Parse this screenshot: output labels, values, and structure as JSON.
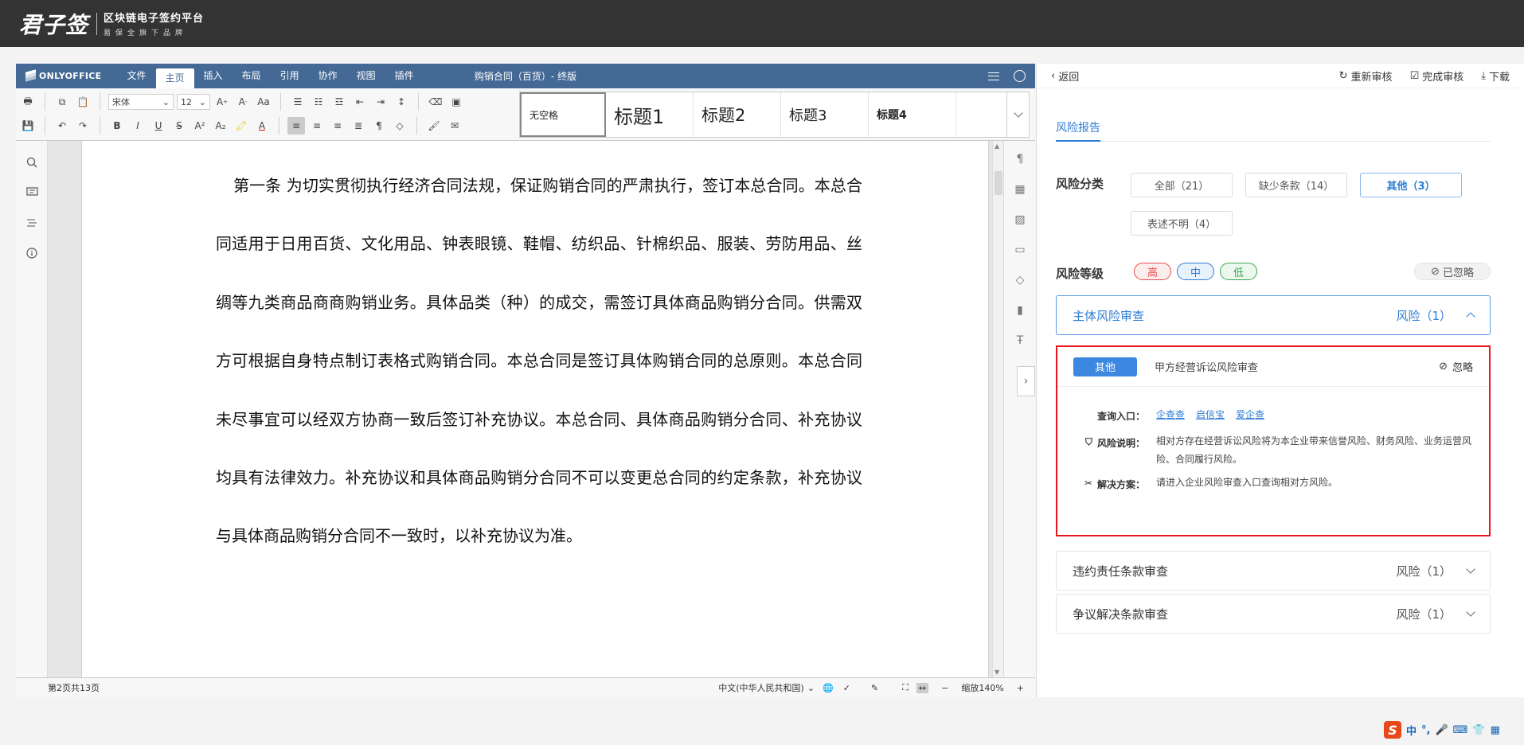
{
  "app": {
    "logo_script": "君子签",
    "logo_main": "区块链电子签约平台",
    "logo_sub": "易保全旗下品牌"
  },
  "editor": {
    "brand": "ONLYOFFICE",
    "tabs": [
      "文件",
      "主页",
      "插入",
      "布局",
      "引用",
      "协作",
      "视图",
      "插件"
    ],
    "active_tab": "主页",
    "doc_title": "购销合同（百货）- 终版",
    "font_name": "宋体",
    "font_size": "12",
    "styles": [
      "无空格",
      "标题1",
      "标题2",
      "标题3",
      "标题4"
    ],
    "document_text": "第一条  为切实贯彻执行经济合同法规，保证购销合同的严肃执行，签订本总合同。本总合同适用于日用百货、文化用品、钟表眼镜、鞋帽、纺织品、针棉织品、服装、劳防用品、丝绸等九类商品商商购销业务。具体品类（种）的成交，需签订具体商品购销分合同。供需双方可根据自身特点制订表格式购销合同。本总合同是签订具体购销合同的总原则。本总合同未尽事宜可以经双方协商一致后签订补充协议。本总合同、具体商品购销分合同、补充协议均具有法律效力。补充协议和具体商品购销分合同不可以变更总合同的约定条款，补充协议与具体商品购销分合同不一致时，以补充协议为准。",
    "status": {
      "page_info": "第2页共13页",
      "language": "中文(中华人民共和国)",
      "zoom": "缩放140%"
    }
  },
  "panel": {
    "back": "返回",
    "recheck": "重新审核",
    "finish": "完成审核",
    "download": "下载",
    "report_tab": "风险报告",
    "category_label": "风险分类",
    "categories": [
      {
        "label": "全部（21）",
        "active": false
      },
      {
        "label": "缺少条款（14）",
        "active": false
      },
      {
        "label": "其他（3）",
        "active": true
      },
      {
        "label": "表述不明（4）",
        "active": false
      }
    ],
    "level_label": "风险等级",
    "levels": [
      {
        "label": "高",
        "color": "#e84c4c",
        "bg": "#fdeeee"
      },
      {
        "label": "中",
        "color": "#2d7cd5",
        "bg": "#e8f2fd"
      },
      {
        "label": "低",
        "color": "#3aa652",
        "bg": "#ecf8ee"
      }
    ],
    "ignored": "已忽略",
    "sections": [
      {
        "title": "主体风险审查",
        "risk": "风险（1）",
        "expanded": true
      },
      {
        "title": "违约责任条款审查",
        "risk": "风险（1）",
        "expanded": false
      },
      {
        "title": "争议解决条款审查",
        "risk": "风险（1）",
        "expanded": false
      }
    ],
    "card": {
      "tag": "其他",
      "title": "甲方经营诉讼风险审查",
      "ignore": "忽略",
      "query_label": "查询入口：",
      "query_links": [
        "企查查",
        "启信宝",
        "爱企查"
      ],
      "desc_label": "风险说明：",
      "desc": "相对方存在经营诉讼风险将为本企业带来信誉风险、财务风险、业务运营风险、合同履行风险。",
      "solution_label": "解决方案：",
      "solution": "请进入企业风险审查入口查询相对方风险。"
    }
  },
  "ime": {
    "lang": "中"
  }
}
